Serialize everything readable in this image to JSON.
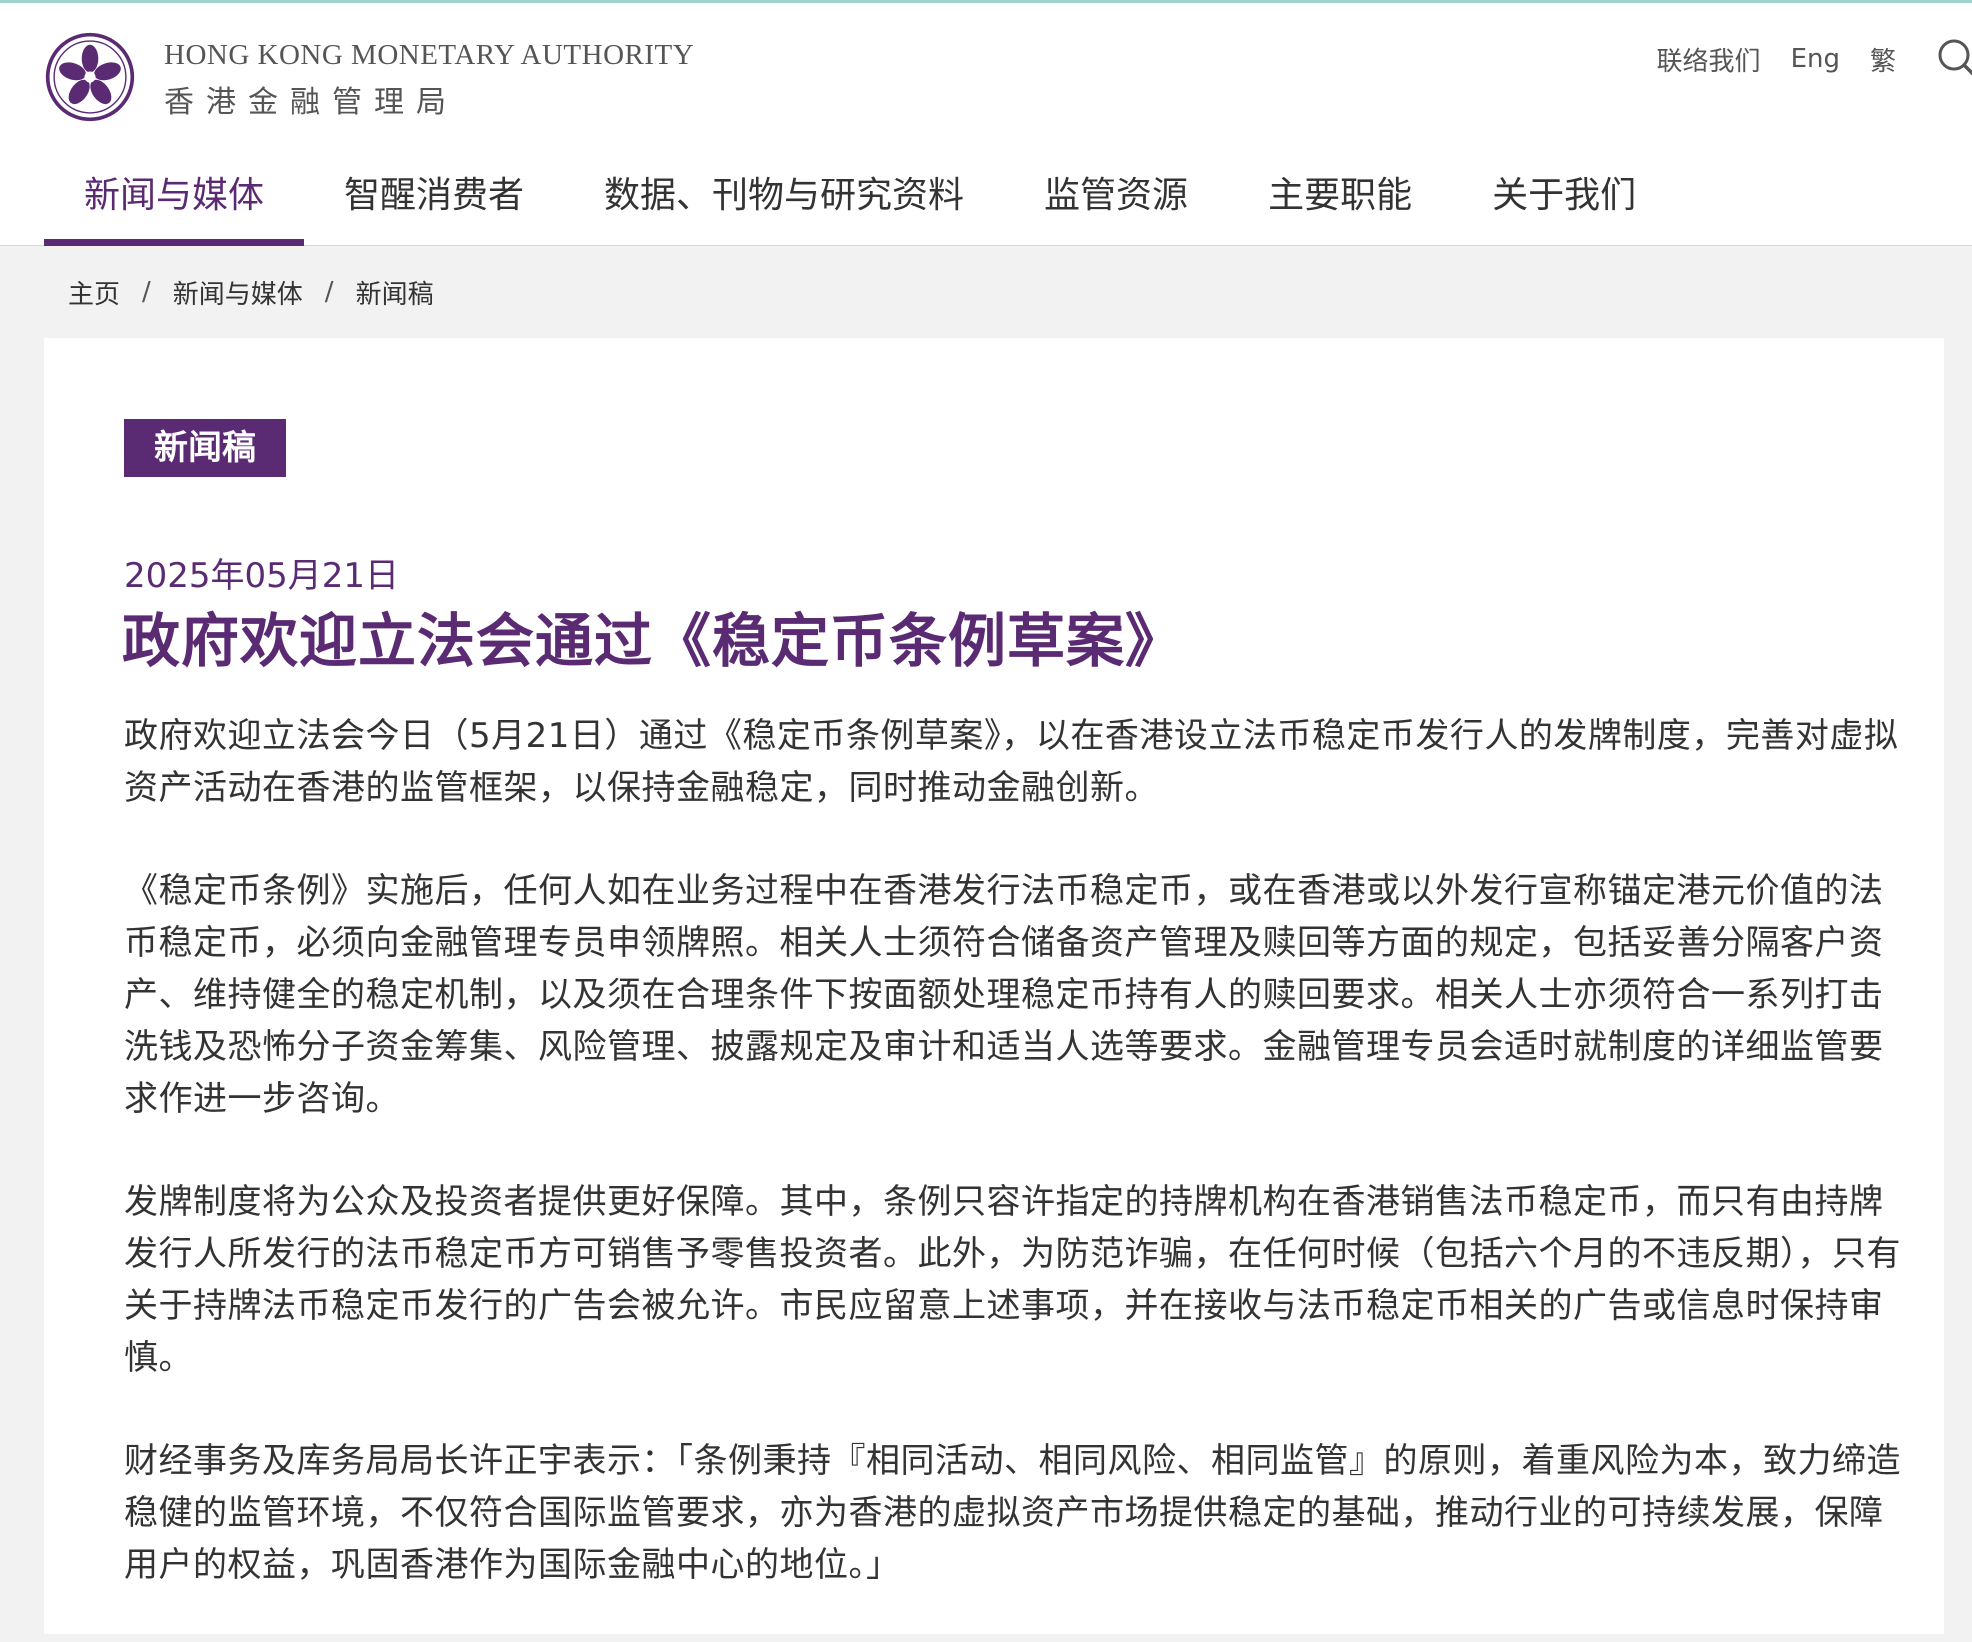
{
  "brand": {
    "org_en": "HONG KONG MONETARY AUTHORITY",
    "org_zh": "香港金融管理局",
    "accent_color": "#5a2a73"
  },
  "utility_nav": {
    "contact_label": "联络我们",
    "lang_en_label": "Eng",
    "lang_tc_label": "繁",
    "search_icon": "search-icon"
  },
  "main_nav": {
    "items": [
      {
        "label": "新闻与媒体",
        "active": true
      },
      {
        "label": "智醒消费者",
        "active": false
      },
      {
        "label": "数据、刊物与研究资料",
        "active": false
      },
      {
        "label": "监管资源",
        "active": false
      },
      {
        "label": "主要职能",
        "active": false
      },
      {
        "label": "关于我们",
        "active": false
      }
    ]
  },
  "breadcrumb": {
    "items": [
      "主页",
      "新闻与媒体",
      "新闻稿"
    ],
    "separator": "/"
  },
  "article": {
    "badge": "新闻稿",
    "date": "2025年05月21日",
    "title": "政府欢迎立法会通过《稳定币条例草案》",
    "paragraphs": [
      "政府欢迎立法会今日（5月21日）通过《稳定币条例草案》，以在香港设立法币稳定币发行人的发牌制度，完善对虚拟资产活动在香港的监管框架，以保持金融稳定，同时推动金融创新。",
      "《稳定币条例》实施后，任何人如在业务过程中在香港发行法币稳定币，或在香港或以外发行宣称锚定港元价值的法币稳定币，必须向金融管理专员申领牌照。相关人士须符合储备资产管理及赎回等方面的规定，包括妥善分隔客户资产、维持健全的稳定机制，以及须在合理条件下按面额处理稳定币持有人的赎回要求。相关人士亦须符合一系列打击洗钱及恐怖分子资金筹集、风险管理、披露规定及审计和适当人选等要求。金融管理专员会适时就制度的详细监管要求作进一步咨询。",
      "发牌制度将为公众及投资者提供更好保障。其中，条例只容许指定的持牌机构在香港销售法币稳定币，而只有由持牌发行人所发行的法币稳定币方可销售予零售投资者。此外，为防范诈骗，在任何时候（包括六个月的不违反期），只有关于持牌法币稳定币发行的广告会被允许。市民应留意上述事项，并在接收与法币稳定币相关的广告或信息时保持审慎。",
      "财经事务及库务局局长许正宇表示：「条例秉持『相同活动、相同风险、相同监管』的原则，着重风险为本，致力缔造稳健的监管环境，不仅符合国际监管要求，亦为香港的虚拟资产市场提供稳定的基础，推动行业的可持续发展，保障用户的权益，巩固香港作为国际金融中心的地位。」"
    ]
  }
}
